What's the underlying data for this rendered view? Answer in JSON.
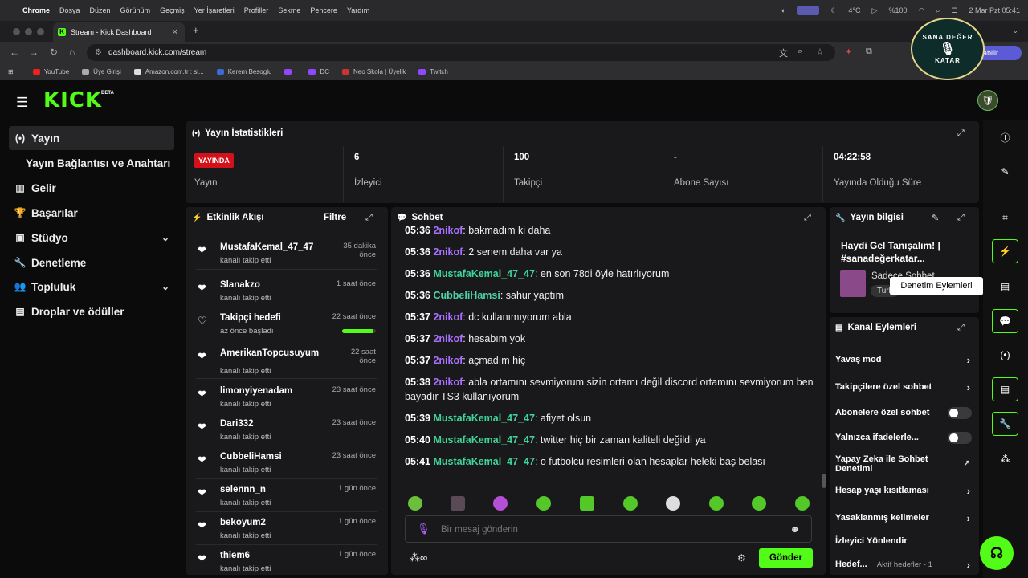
{
  "menubar": {
    "app": "Chrome",
    "items": [
      "Dosya",
      "Düzen",
      "Görünüm",
      "Geçmiş",
      "Yer İşaretleri",
      "Profiller",
      "Sekme",
      "Pencere",
      "Yardım"
    ],
    "weather": "4°C",
    "battery": "%100",
    "datetime": "2 Mar Pzt  05:41"
  },
  "browser": {
    "tab_title": "Stream - Kick Dashboard",
    "url": "dashboard.kick.com/stream",
    "bookmarks": [
      "YouTube",
      "Üye Girişi",
      "Amazon.com.tr : si...",
      "Kerem Besoglu",
      "",
      "DC",
      "Neo Skola | Üyelik",
      "Twitch"
    ],
    "share_label": "abilir"
  },
  "badge": {
    "line1": "SANA DEĞER",
    "line2": "KATAR"
  },
  "header": {
    "logo": "KICK",
    "beta": "BETA"
  },
  "sidebar": {
    "items": [
      {
        "label": "Yayın"
      },
      {
        "label": "Yayın Bağlantısı ve Anahtarı"
      },
      {
        "label": "Gelir"
      },
      {
        "label": "Başarılar"
      },
      {
        "label": "Stüdyo"
      },
      {
        "label": "Denetleme"
      },
      {
        "label": "Topluluk"
      },
      {
        "label": "Droplar ve ödüller"
      }
    ]
  },
  "stats": {
    "title": "Yayın İstatistikleri",
    "live_badge": "YAYINDA",
    "live_label": "Yayın",
    "viewers_value": "6",
    "viewers_label": "İzleyici",
    "followers_value": "100",
    "followers_label": "Takipçi",
    "subs_value": "-",
    "subs_label": "Abone Sayısı",
    "uptime_value": "04:22:58",
    "uptime_label": "Yayında Olduğu Süre"
  },
  "activity": {
    "title": "Etkinlik Akışı",
    "filter": "Filtre",
    "goal_progress": 0.9,
    "events": [
      {
        "name": "MustafaKemal_47_47",
        "sub": "kanalı takip etti",
        "time": "35 dakika önce"
      },
      {
        "name": "Slanakzo",
        "sub": "kanalı takip etti",
        "time": "1 saat önce"
      },
      {
        "name": "Takipçi hedefi",
        "sub": "az önce başladı",
        "time": "22 saat önce"
      },
      {
        "name": "AmerikanTopcusuyum",
        "sub": "kanalı takip etti",
        "time": "22 saat önce"
      },
      {
        "name": "limonyiyenadam",
        "sub": "kanalı takip etti",
        "time": "23 saat önce"
      },
      {
        "name": "Dari332",
        "sub": "kanalı takip etti",
        "time": "23 saat önce"
      },
      {
        "name": "CubbeliHamsi",
        "sub": "kanalı takip etti",
        "time": "23 saat önce"
      },
      {
        "name": "selennn_n",
        "sub": "kanalı takip etti",
        "time": "1 gün önce"
      },
      {
        "name": "bekoyum2",
        "sub": "kanalı takip etti",
        "time": "1 gün önce"
      },
      {
        "name": "thiem6",
        "sub": "kanalı takip etti",
        "time": "1 gün önce"
      }
    ]
  },
  "chat": {
    "title": "Sohbet",
    "messages": [
      {
        "time": "05:36",
        "user": "2nikof",
        "text": ": bakmadım ki daha"
      },
      {
        "time": "05:36",
        "user": "2nikof",
        "text": ": 2 senem daha var ya"
      },
      {
        "time": "05:36",
        "user": "MustafaKemal_47_47",
        "text": ": en son 78di öyle hatırlıyorum"
      },
      {
        "time": "05:36",
        "user": "CubbeliHamsi",
        "text": ": sahur yaptım"
      },
      {
        "time": "05:37",
        "user": "2nikof",
        "text": ": dc kullanımıyorum abla"
      },
      {
        "time": "05:37",
        "user": "2nikof",
        "text": ": hesabım yok"
      },
      {
        "time": "05:37",
        "user": "2nikof",
        "text": ": açmadım hiç"
      },
      {
        "time": "05:38",
        "user": "2nikof",
        "text": ": abla ortamını sevmiyorum sizin ortamı değil discord ortamını sevmiyorum ben bayadır TS3 kullanıyorum"
      },
      {
        "time": "05:39",
        "user": "MustafaKemal_47_47",
        "text": ": afiyet olsun"
      },
      {
        "time": "05:40",
        "user": "MustafaKemal_47_47",
        "text": ": twitter hiç bir zaman kaliteli değildi ya"
      },
      {
        "time": "05:41",
        "user": "MustafaKemal_47_47",
        "text": ": o futbolcu resimleri olan hesaplar heleki baş belası"
      }
    ],
    "input_placeholder": "Bir mesaj gönderin",
    "send_label": "Gönder"
  },
  "stream_info": {
    "title": "Yayın bilgisi",
    "stream_title": "Haydi Gel Tanışalım! | #sanadeğerkatar...",
    "category": "Sadece Sohbet",
    "tag": "Turk"
  },
  "channel_actions": {
    "title": "Kanal Eylemleri",
    "items": [
      {
        "label": "Yavaş mod"
      },
      {
        "label": "Takipçilere özel sohbet"
      },
      {
        "label": "Abonelere özel sohbet"
      },
      {
        "label": "Yalnızca ifadelerle..."
      },
      {
        "label": "Yapay Zeka ile Sohbet Denetimi"
      },
      {
        "label": "Hesap yaşı kısıtlaması"
      },
      {
        "label": "Yasaklanmış kelimeler"
      },
      {
        "label": "İzleyici Yönlendir"
      },
      {
        "label": "Hedef...",
        "extra": "Aktif hedefler - 1"
      }
    ]
  },
  "tooltip": "Denetim Eylemleri",
  "colors": {
    "accent": "#53fc18",
    "live": "#d3111a",
    "user_purple": "#a970ff",
    "user_green": "#3fd59a"
  }
}
